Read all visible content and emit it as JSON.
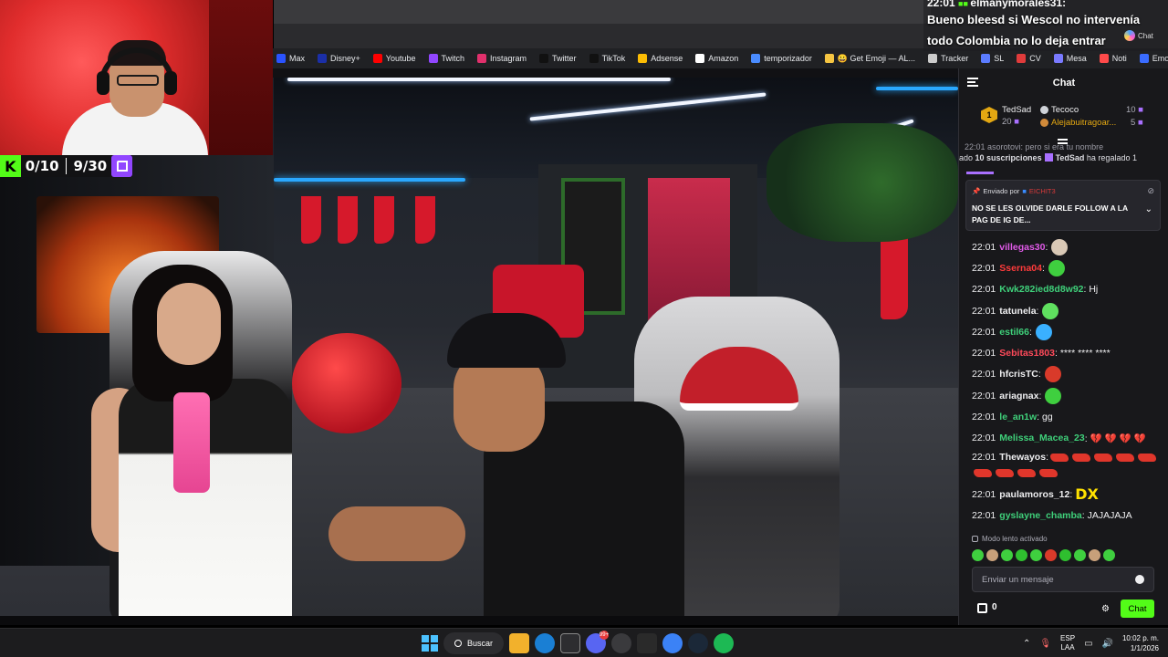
{
  "bookmarks": [
    {
      "label": "Max",
      "color": "#2a53ff"
    },
    {
      "label": "Disney+",
      "color": "#1b2fa8"
    },
    {
      "label": "Youtube",
      "color": "#ff0000"
    },
    {
      "label": "Twitch",
      "color": "#9146ff"
    },
    {
      "label": "Instagram",
      "color": "#e1306c"
    },
    {
      "label": "Twitter",
      "color": "#111111"
    },
    {
      "label": "TikTok",
      "color": "#111111"
    },
    {
      "label": "Adsense",
      "color": "#fbbc04"
    },
    {
      "label": "Amazon",
      "color": "#ffffff"
    },
    {
      "label": "temporizador",
      "color": "#4a8cff"
    },
    {
      "label": "😀 Get Emoji — AL...",
      "color": "#f5c542"
    },
    {
      "label": "Tracker",
      "color": "#cccccc"
    },
    {
      "label": "SL",
      "color": "#5b7cff"
    },
    {
      "label": "CV",
      "color": "#e03b3b"
    },
    {
      "label": "Mesa",
      "color": "#7a7aff"
    },
    {
      "label": "Noti",
      "color": "#ff4a4a"
    },
    {
      "label": "Emogis",
      "color": "#3a6cff"
    }
  ],
  "counters": {
    "kick_logo": "K",
    "kick_count": "0/10",
    "twitch_count": "9/30"
  },
  "ticker": {
    "time_user": "22:01 ",
    "user": "elmanymorales31",
    "line1": "Bueno bleesd si Wescol no intervenía",
    "line2": "todo Colombia no lo deja entrar",
    "chat_label": "Chat"
  },
  "chat": {
    "title": "Chat",
    "leaderboard": [
      {
        "rank": "1",
        "name": "TedSad",
        "value": "20"
      },
      {
        "name": "Tecoco",
        "value": "10"
      },
      {
        "name": "Alejabuitragoar...",
        "value": "5"
      }
    ],
    "sub_row1": "22:01 asorotovi: pero si era tu nombre",
    "sub_row2_pre": "ado ",
    "sub_row2_count": "10 suscripciones",
    "sub_row2_user": "TedSad",
    "sub_row2_post": " ha regalado 1",
    "pinned": {
      "prefix": "Enviado por",
      "user": "EICHIT3",
      "text": "NO SE LES OLVIDE DARLE FOLLOW A LA PAG DE IG DE..."
    },
    "messages": [
      {
        "time": "22:01",
        "user": "villegas30",
        "color": "#e05ae8",
        "text": ":",
        "emote": "#d9c8b6"
      },
      {
        "time": "22:01",
        "user": "Sserna04",
        "color": "#ff3b3b",
        "text": ":",
        "emote": "#3fcf3f"
      },
      {
        "time": "22:01",
        "user": "Kwk282ied8d8w92",
        "color": "#3fd07a",
        "text": ": Hj"
      },
      {
        "time": "22:01",
        "user": "tatunela",
        "color": "#efeff1",
        "text": ":",
        "emote": "#5fe05f"
      },
      {
        "time": "22:01",
        "user": "estil66",
        "color": "#3fd07a",
        "text": ":",
        "emote": "#3ab0ff"
      },
      {
        "time": "22:01",
        "user": "Sebitas1803",
        "color": "#ff4a5a",
        "text": ": **** **** ****"
      },
      {
        "time": "22:01",
        "user": "hfcrisTC",
        "color": "#efeff1",
        "text": ":",
        "emote": "#d93a2a"
      },
      {
        "time": "22:01",
        "user": "ariagnax",
        "color": "#efeff1",
        "text": ":",
        "emote": "#3fcf3f"
      },
      {
        "time": "22:01",
        "user": "le_an1w",
        "color": "#3fd07a",
        "text": ": gg"
      },
      {
        "time": "22:01",
        "user": "Melissa_Macea_23",
        "color": "#3fd07a",
        "text": ": 💔 💔 💔 💔"
      },
      {
        "time": "22:01",
        "user": "Thewayos",
        "color": "#efeff1",
        "text": ":"
      },
      {
        "time": "22:01",
        "user": "paulamoros_12",
        "color": "#efeff1",
        "text": ":",
        "dx": "DX"
      },
      {
        "time": "22:01",
        "user": "gyslayne_chamba",
        "color": "#3fd07a",
        "text": ": JAJAJAJA"
      }
    ],
    "slowmode": "Modo lento activado",
    "input_placeholder": "Enviar un mensaje",
    "points": "0",
    "send_label": "Chat"
  },
  "taskbar": {
    "search_label": "Buscar",
    "badge_count": "99+",
    "lang_top": "ESP",
    "lang_bottom": "LAA",
    "time": "10:02 p. m.",
    "date": "1/1/2026"
  }
}
